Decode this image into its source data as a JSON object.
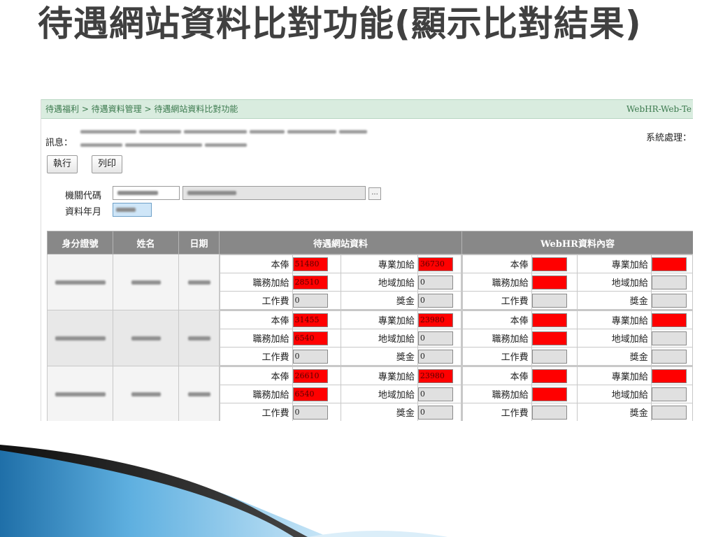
{
  "slide_title": "待遇網站資料比對功能(顯示比對結果)",
  "breadcrumb": "待遇福利 > 待遇資料管理 > 待遇網站資料比對功能",
  "system_name": "WebHR-Web-Te",
  "message_label": "訊息：",
  "system_process_label": "系統處理：",
  "buttons": {
    "execute": "執行",
    "print": "列印"
  },
  "form": {
    "agency_code_label": "機關代碼",
    "data_month_label": "資料年月",
    "lookup_button": "..."
  },
  "table": {
    "headers": [
      "身分證號",
      "姓名",
      "日期",
      "待遇網站資料",
      "WebHR資料內容"
    ],
    "field_labels": {
      "base_pay": "本俸",
      "professional_allowance": "專業加給",
      "duty_allowance": "職務加給",
      "regional_allowance": "地域加給",
      "work_fee": "工作費",
      "bonus": "獎金"
    },
    "rows": [
      {
        "site": {
          "base_pay": "51480",
          "professional_allowance": "36730",
          "duty_allowance": "28510",
          "regional_allowance": "0",
          "work_fee": "0",
          "bonus": "0"
        }
      },
      {
        "site": {
          "base_pay": "31455",
          "professional_allowance": "23980",
          "duty_allowance": "6540",
          "regional_allowance": "0",
          "work_fee": "0",
          "bonus": "0"
        }
      },
      {
        "site": {
          "base_pay": "26610",
          "professional_allowance": "23980",
          "duty_allowance": "6540",
          "regional_allowance": "0",
          "work_fee": "0",
          "bonus": "0"
        }
      }
    ]
  },
  "colors": {
    "mismatch": "#ff0000",
    "header_bg": "#888888",
    "breadcrumb_bg": "#d9ecdf",
    "title": "#404040"
  }
}
